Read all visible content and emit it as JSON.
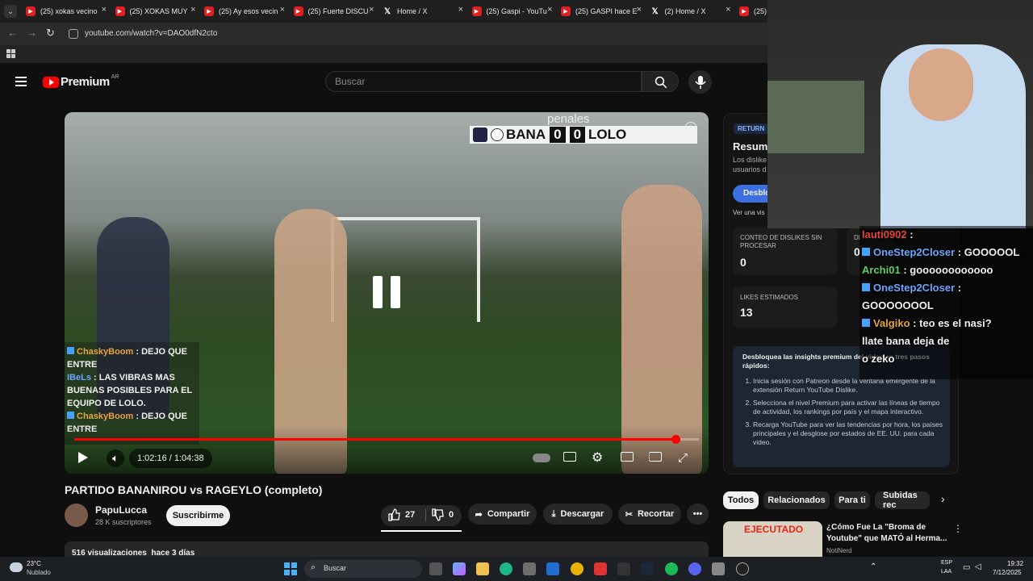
{
  "browser": {
    "tabs": [
      {
        "title": "(25) xokas vecino",
        "icon": "youtube-icon"
      },
      {
        "title": "(25) XOKAS MUY",
        "icon": "youtube-icon"
      },
      {
        "title": "(25) Ay esos vecin",
        "icon": "youtube-icon"
      },
      {
        "title": "(25) Fuerte DISCU",
        "icon": "youtube-icon"
      },
      {
        "title": "Home / X",
        "icon": "x-icon"
      },
      {
        "title": "(25) Gaspi - YouTu",
        "icon": "youtube-icon"
      },
      {
        "title": "(25) GASPI hace E",
        "icon": "youtube-icon"
      },
      {
        "title": "(2) Home / X",
        "icon": "x-icon"
      },
      {
        "title": "(25)",
        "icon": "youtube-icon"
      }
    ],
    "url": "youtube.com/watch?v=DAO0dfN2cto"
  },
  "yt": {
    "logo_text": "Premium",
    "region": "AR",
    "search_placeholder": "Buscar"
  },
  "video": {
    "overlay_scoreboard_top": "penales",
    "team1": "BANA",
    "score1": "0",
    "score2": "0",
    "team2": "LOLO",
    "time": "1:02:16 / 1:04:38",
    "progress": 0.963,
    "title": "PARTIDO BANANIROU vs RAGEYLO (completo)",
    "chat": [
      {
        "user": "ChaskyBoom",
        "msg": "DEJO QUE ENTRE",
        "color": "#e6a53a"
      },
      {
        "user": "IBeLs",
        "msg": "LAS VIBRAS MAS BUENAS POSIBLES PARA EL EQUIPO DE LOLO.",
        "color": "#6aa7ff"
      },
      {
        "user": "ChaskyBoom",
        "msg": "DEJO QUE ENTRE",
        "color": "#e6a53a"
      }
    ]
  },
  "channel": {
    "name": "PapuLucca",
    "subs": "28 K suscriptores",
    "subscribe_label": "Suscribirme"
  },
  "actions": {
    "likes": "27",
    "dislikes": "0",
    "share": "Compartir",
    "download": "Descargar",
    "clip": "Recortar"
  },
  "description_peek": "516 visualizaciones  hace 3 días",
  "ryd_panel": {
    "badge": "RETURN",
    "heading": "Resume",
    "desc": "Los dislike usuarios d",
    "button": "Desblo",
    "link": "Ver una vis",
    "card1_label": "CONTEO DE DISLIKES SIN PROCESAR",
    "card1_value": "0",
    "card2_label": "DI",
    "card2_value": "0",
    "card3_label": "LIKES ESTIMADOS",
    "card3_value": "13",
    "insights_title": "Desbloquea las insights premium del video en tres pasos rápidos:",
    "steps": [
      "Inicia sesión con Patreon desde la ventana emergente de la extensión Return YouTube Dislike.",
      "Selecciona el nivel Premium para activar las líneas de tiempo de actividad, los rankings por país y el mapa interactivo.",
      "Recarga YouTube para ver las tendencias por hora, los países principales y el desglose por estados de EE. UU. para cada video."
    ]
  },
  "chips": [
    "Todos",
    "Relacionados",
    "Para ti",
    "Subidas rec"
  ],
  "recommended": {
    "title": "¿Cómo Fue La \"Broma de Youtube\" que MATÓ al Herma...",
    "channel": "NotiNerd",
    "thumb_text": "EJECUTADO"
  },
  "stream_chat": [
    {
      "user": "lauti0902",
      "msg": "",
      "color": "#e8453c"
    },
    {
      "user": "OneStep2Closer",
      "msg": "GOOOOOL",
      "color": "#6aa7ff"
    },
    {
      "user": "Archi01",
      "msg": "goooooooooooo",
      "color": "#5fd35f"
    },
    {
      "user": "OneStep2Closer",
      "msg": "GOOOOOOOL",
      "color": "#6aa7ff"
    },
    {
      "user": "Valgiko",
      "msg": "teo es el nasi?",
      "color": "#e6a53a"
    },
    {
      "user": "",
      "msg": "llate bana deja de",
      "color": "#ffffff"
    },
    {
      "user": "",
      "msg": "o zeko",
      "color": "#ffffff"
    }
  ],
  "taskbar": {
    "weather_temp": "23°C",
    "weather_desc": "Nublado",
    "search": "Buscar",
    "lang1": "ESP",
    "lang2": "LAA",
    "time": "19:32",
    "date": "7/12/2025"
  }
}
